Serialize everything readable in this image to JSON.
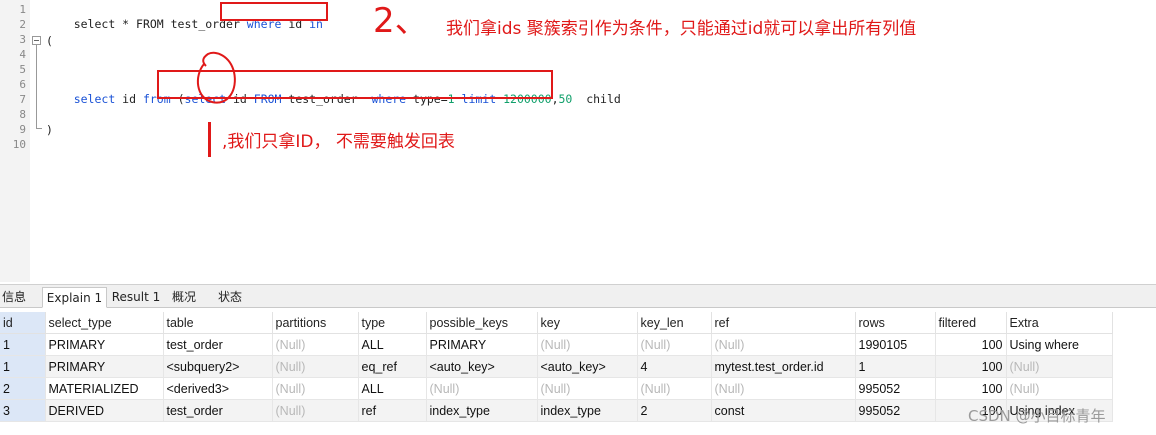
{
  "editor": {
    "line_numbers": [
      "1",
      "2",
      "3",
      "4",
      "5",
      "6",
      "7",
      "8",
      "9",
      "10"
    ],
    "line1": {
      "a": "select * FROM test_order ",
      "b": "where",
      "c": " id ",
      "d": "in"
    },
    "line3": "(",
    "line6": {
      "a": "select",
      "b": " id ",
      "c": "from",
      "d": " (",
      "e": "select",
      "f": " id ",
      "g": "FROM",
      "h": " test_order  ",
      "i": "where",
      "j": " type=",
      "k": "1",
      "l": " ",
      "m": "limit",
      "n": " ",
      "o": "1200000",
      "p": ",",
      "q": "50",
      "r": "  child"
    },
    "line9": ")",
    "annotation_num": "2、",
    "annotation_top": "我们拿ids 聚簇索引作为条件，只能通过id就可以拿出所有列值",
    "annotation_mid": ",我们只拿ID， 不需要触发回表"
  },
  "tabs": [
    "信息",
    "Explain 1",
    "Result 1",
    "概况",
    "状态"
  ],
  "active_tab": "Explain 1",
  "grid": {
    "columns": [
      "id",
      "select_type",
      "table",
      "partitions",
      "type",
      "possible_keys",
      "key",
      "key_len",
      "ref",
      "rows",
      "filtered",
      "Extra"
    ],
    "rows": [
      [
        "1",
        "PRIMARY",
        "test_order",
        "(Null)",
        "ALL",
        "PRIMARY",
        "(Null)",
        "(Null)",
        "(Null)",
        "1990105",
        "100",
        "Using where"
      ],
      [
        "1",
        "PRIMARY",
        "<subquery2>",
        "(Null)",
        "eq_ref",
        "<auto_key>",
        "<auto_key>",
        "4",
        "mytest.test_order.id",
        "1",
        "100",
        "(Null)"
      ],
      [
        "2",
        "MATERIALIZED",
        "<derived3>",
        "(Null)",
        "ALL",
        "(Null)",
        "(Null)",
        "(Null)",
        "(Null)",
        "995052",
        "100",
        "(Null)"
      ],
      [
        "3",
        "DERIVED",
        "test_order",
        "(Null)",
        "ref",
        "index_type",
        "index_type",
        "2",
        "const",
        "995052",
        "100",
        "Using index"
      ]
    ]
  },
  "watermark": "CSDN @小目标青年",
  "colors": {
    "keyword": "#1a52d6",
    "number": "#11a06b",
    "annotation": "#e01919"
  }
}
